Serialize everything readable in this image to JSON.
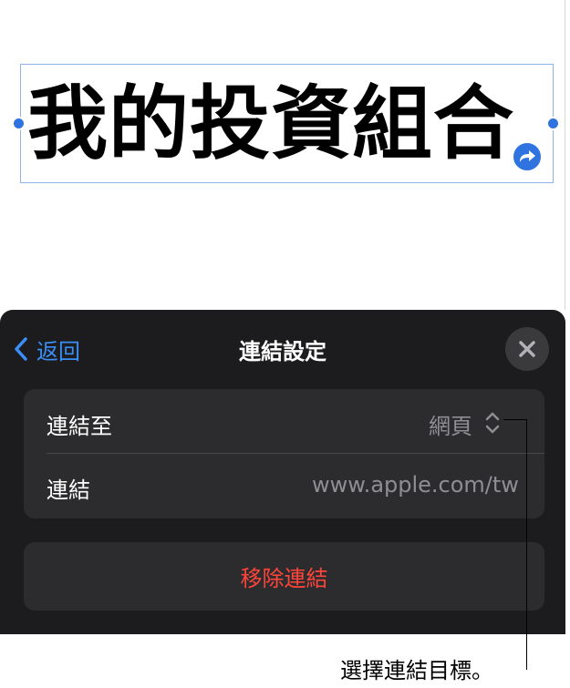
{
  "document": {
    "title_text": "我的投資組合"
  },
  "panel": {
    "back_label": "返回",
    "title": "連結設定",
    "rows": [
      {
        "label": "連結至",
        "value": "網頁"
      },
      {
        "label": "連結",
        "value": "www.apple.com/tw"
      }
    ],
    "remove_label": "移除連結"
  },
  "callout": {
    "text": "選擇連結目標。"
  },
  "colors": {
    "accent": "#3a8ef6",
    "destructive": "#ff453a",
    "panel_bg": "#1c1c1e",
    "group_bg": "#2c2c2e",
    "selection": "#2f73e0"
  },
  "icons": [
    "chevron-left-icon",
    "close-icon",
    "up-down-chevron-icon",
    "link-arrow-icon"
  ]
}
